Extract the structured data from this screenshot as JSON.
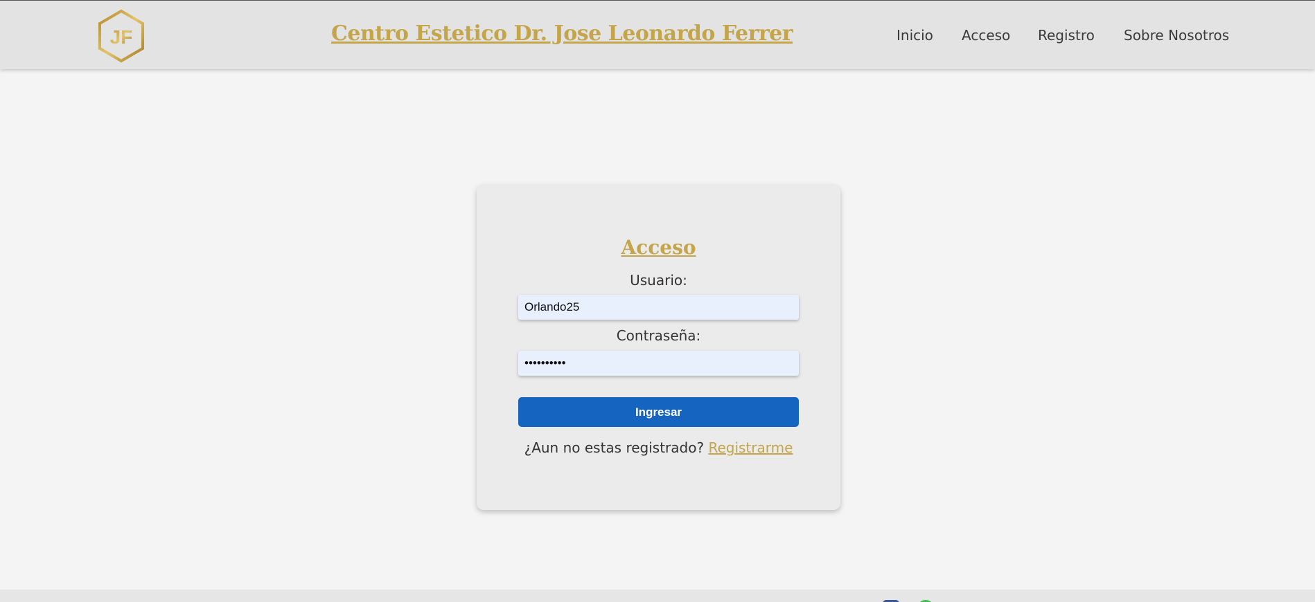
{
  "header": {
    "logo_text": "JF",
    "title": "Centro Estetico Dr. Jose Leonardo Ferrer",
    "nav": [
      "Inicio",
      "Acceso",
      "Registro",
      "Sobre Nosotros"
    ]
  },
  "login": {
    "title": "Acceso",
    "user_label": "Usuario:",
    "user_value": "Orlando25",
    "password_label": "Contraseña:",
    "password_value": "••••••••••",
    "submit_label": "Ingresar",
    "register_prompt": "¿Aun no estas registrado?",
    "register_link": "Registrarme"
  },
  "footer": {
    "social_icons": [
      "facebook-icon",
      "whatsapp-icon"
    ]
  },
  "colors": {
    "accent_gold": "#c4a54a",
    "button_blue": "#1565c0",
    "background": "#f4f4f4"
  }
}
